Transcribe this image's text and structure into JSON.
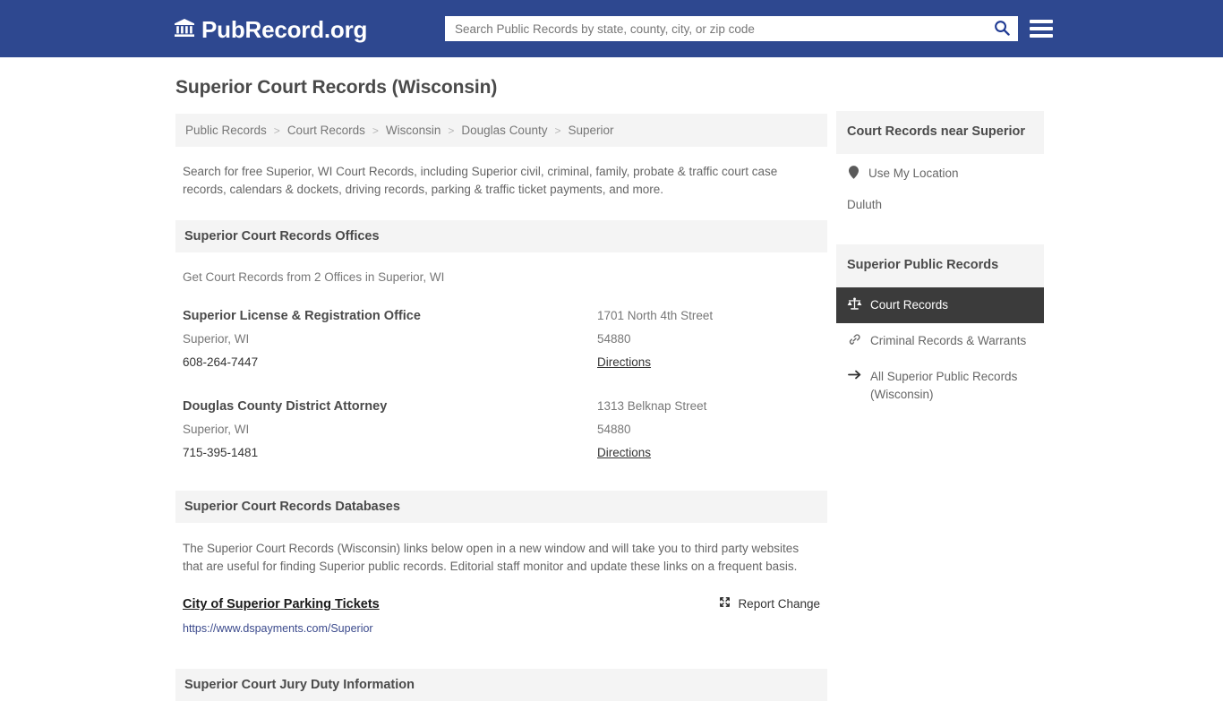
{
  "header": {
    "logo_text": "PubRecord.org",
    "logo_icon": "bank-building-icon",
    "search_placeholder": "Search Public Records by state, county, city, or zip code",
    "search_value": "",
    "search_icon": "search-icon",
    "menu_icon": "hamburger-menu-icon",
    "background_color": "#2e4890"
  },
  "main": {
    "page_title": "Superior Court Records (Wisconsin)",
    "breadcrumb": {
      "separator": ">",
      "items": [
        {
          "label": "Public Records"
        },
        {
          "label": "Court Records"
        },
        {
          "label": "Wisconsin"
        },
        {
          "label": "Douglas County"
        },
        {
          "label": "Superior"
        }
      ]
    },
    "intro": "Search for free Superior, WI Court Records, including Superior civil, criminal, family, probate & traffic court case records, calendars & dockets, driving records, parking & traffic ticket payments, and more.",
    "offices_section": {
      "heading": "Superior Court Records Offices",
      "subheading": "Get Court Records from 2 Offices in Superior, WI",
      "directions_label": "Directions",
      "items": [
        {
          "name": "Superior License & Registration Office",
          "city_state": "Superior, WI",
          "phone": "608-264-7447",
          "street": "1701 North 4th Street",
          "zip": "54880"
        },
        {
          "name": "Douglas County District Attorney",
          "city_state": "Superior, WI",
          "phone": "715-395-1481",
          "street": "1313 Belknap Street",
          "zip": "54880"
        }
      ]
    },
    "databases_section": {
      "heading": "Superior Court Records Databases",
      "description": "The Superior Court Records (Wisconsin) links below open in a new window and will take you to third party websites that are useful for finding Superior public records. Editorial staff monitor and update these links on a frequent basis.",
      "entry": {
        "title": "City of Superior Parking Tickets",
        "url": "https://www.dspayments.com/Superior"
      },
      "report_change": {
        "label": "Report Change",
        "icon": "broken-link-icon"
      }
    },
    "jury_section": {
      "heading": "Superior Court Jury Duty Information"
    }
  },
  "sidebar": {
    "near_panel": {
      "heading": "Court Records near Superior",
      "use_my_location": {
        "label": "Use My Location",
        "icon": "map-pin-icon"
      },
      "nearby": [
        {
          "label": "Duluth"
        }
      ]
    },
    "records_panel": {
      "heading": "Superior Public Records",
      "items": [
        {
          "label": "Court Records",
          "icon": "scales-of-justice-icon",
          "active": true
        },
        {
          "label": "Criminal Records & Warrants",
          "icon": "link-chain-icon",
          "active": false
        },
        {
          "label": "All Superior Public Records (Wisconsin)",
          "icon": "arrow-right-icon",
          "active": false
        }
      ]
    }
  },
  "colors": {
    "brand_blue": "#2e4890",
    "panel_gray": "#f4f4f4",
    "active_dark": "#3b3b3b",
    "link_blue": "#3b4a8c"
  }
}
